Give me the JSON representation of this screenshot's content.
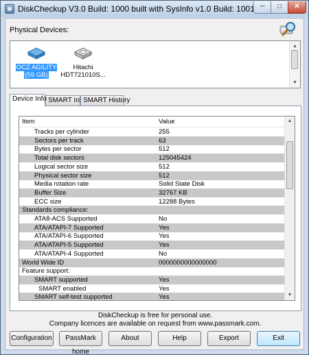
{
  "window": {
    "title": "DiskCheckup V3.0 Build: 1000 built with SysInfo v1.0 Build: 1001",
    "minimize": "─",
    "maximize": "□",
    "close": "✕"
  },
  "physical_devices": {
    "label": "Physical Devices:",
    "devices": [
      {
        "line1": "OCZ AGILITY",
        "line2": "(59 GB)",
        "icon": "ssd-icon",
        "selected": true
      },
      {
        "line1": "Hitachi",
        "line2": "HDT721010S...",
        "icon": "hdd-icon",
        "selected": false
      }
    ]
  },
  "tabs": [
    "Device Info",
    "SMART Info",
    "SMART History"
  ],
  "table": {
    "columns": [
      "Item",
      "Value"
    ],
    "rows": [
      {
        "item": "Tracks per cylinder",
        "value": "255",
        "level": 1,
        "shaded": false
      },
      {
        "item": "Sectors per track",
        "value": "63",
        "level": 1,
        "shaded": true
      },
      {
        "item": "Bytes per sector",
        "value": "512",
        "level": 1,
        "shaded": false
      },
      {
        "item": "Total disk sectors",
        "value": "125045424",
        "level": 1,
        "shaded": true
      },
      {
        "item": "Logical sector size",
        "value": "512",
        "level": 1,
        "shaded": false
      },
      {
        "item": "Physical sector size",
        "value": "512",
        "level": 1,
        "shaded": true
      },
      {
        "item": "Media rotation rate",
        "value": "Solid State Disk",
        "level": 1,
        "shaded": false
      },
      {
        "item": "Buffer Size",
        "value": "32767 KB",
        "level": 1,
        "shaded": true
      },
      {
        "item": "ECC size",
        "value": "12288 Bytes",
        "level": 1,
        "shaded": false
      },
      {
        "item": "Standards compliance:",
        "value": "",
        "level": 0,
        "shaded": true
      },
      {
        "item": "ATA8-ACS Supported",
        "value": "No",
        "level": 1,
        "shaded": false
      },
      {
        "item": "ATA/ATAPI-7 Supported",
        "value": "Yes",
        "level": 1,
        "shaded": true
      },
      {
        "item": "ATA/ATAPI-6 Supported",
        "value": "Yes",
        "level": 1,
        "shaded": false
      },
      {
        "item": "ATA/ATAPI-5 Supported",
        "value": "Yes",
        "level": 1,
        "shaded": true
      },
      {
        "item": "ATA/ATAPI-4 Supported",
        "value": "No",
        "level": 1,
        "shaded": false
      },
      {
        "item": "World Wide ID",
        "value": "0000000000000000",
        "level": 0,
        "shaded": true
      },
      {
        "item": "Feature support:",
        "value": "",
        "level": 0,
        "shaded": false
      },
      {
        "item": "SMART supported",
        "value": "Yes",
        "level": 1,
        "shaded": true
      },
      {
        "item": "SMART enabled",
        "value": "Yes",
        "level": 2,
        "shaded": false
      },
      {
        "item": "SMART self-test supported",
        "value": "Yes",
        "level": 1,
        "shaded": true
      }
    ]
  },
  "footer": {
    "line1": "DiskCheckup is free for personal use.",
    "line2": "Company licences are available on request from www.passmark.com."
  },
  "buttons": {
    "configuration": "Configuration",
    "passmark_home": "PassMark home",
    "about": "About",
    "help": "Help",
    "export": "Export",
    "exit": "Exit"
  },
  "colors": {
    "selection": "#3399ff",
    "row_shade": "#c8c8c8"
  }
}
